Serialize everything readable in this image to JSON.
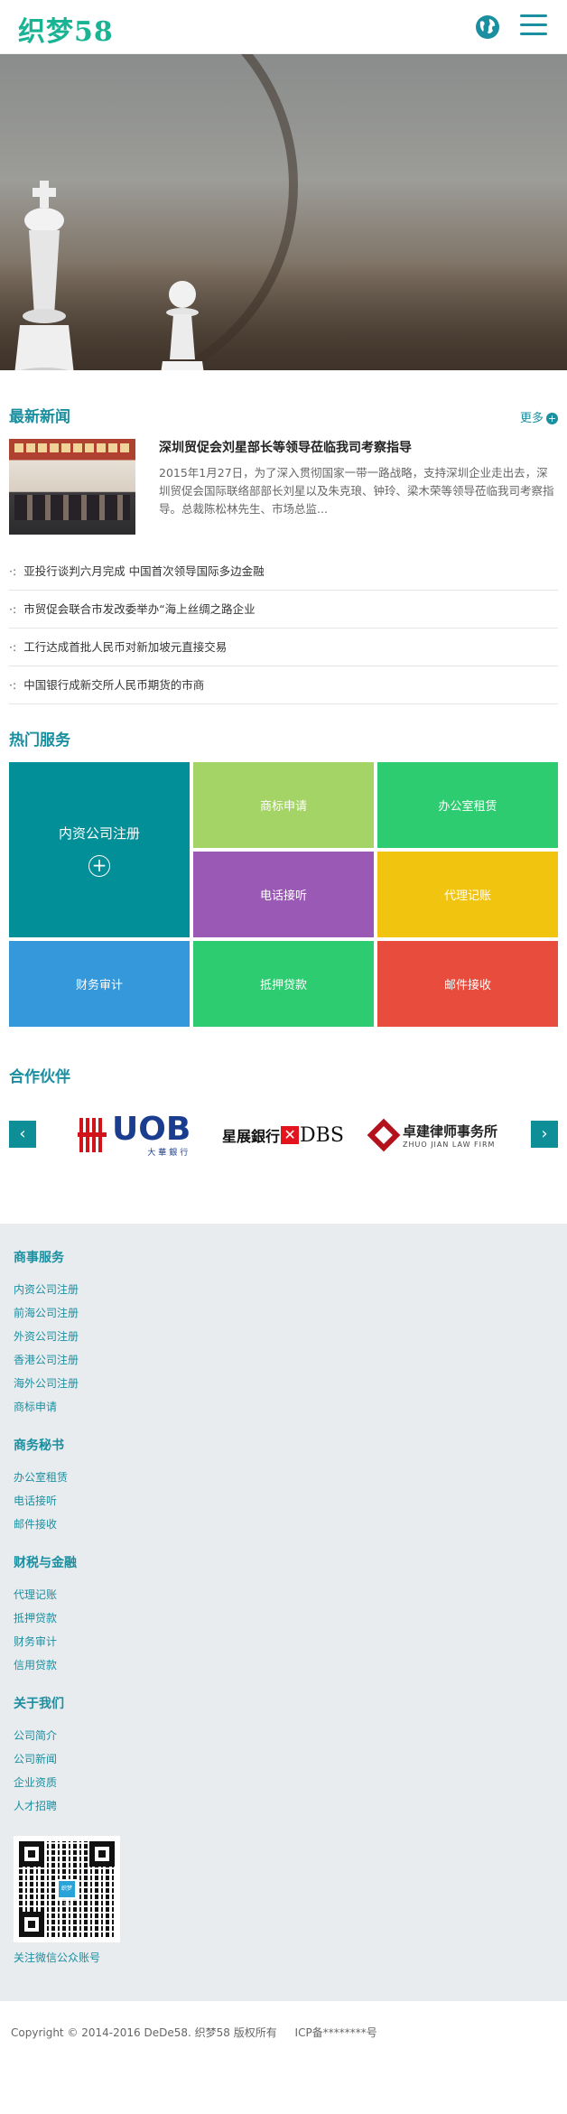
{
  "header": {
    "logo": "织梦58"
  },
  "news": {
    "title": "最新新闻",
    "more": "更多",
    "feature": {
      "title": "深圳贸促会刘星部长等领导莅临我司考察指导",
      "summary": "2015年1月27日，为了深入贯彻国家一带一路战略，支持深圳企业走出去，深圳贸促会国际联络部部长刘星以及朱克琅、钟玲、梁木荣等领导莅临我司考察指导。总裁陈松林先生、市场总监..."
    },
    "items": [
      "亚投行谈判六月完成 中国首次领导国际多边金融",
      "市贸促会联合市发改委举办“海上丝绸之路企业",
      "工行达成首批人民币对新加坡元直接交易",
      "中国银行成新交所人民币期货的市商"
    ]
  },
  "services": {
    "title": "热门服务",
    "tiles": [
      "内资公司注册",
      "商标申请",
      "办公室租赁",
      "电话接听",
      "代理记账",
      "财务审计",
      "抵押贷款",
      "邮件接收"
    ]
  },
  "partners": {
    "title": "合作伙伴",
    "uob": {
      "big": "UOB",
      "small": "大華銀行"
    },
    "dbs": {
      "cn": "星展銀行",
      "x": "✕",
      "en": "DBS"
    },
    "zhuo": {
      "cn": "卓建律师事务所",
      "en": "ZHUO JIAN LAW FIRM"
    },
    "prev": "‹",
    "next": "›"
  },
  "footer": {
    "groups": [
      {
        "title": "商事服务",
        "items": [
          "内资公司注册",
          "前海公司注册",
          "外资公司注册",
          "香港公司注册",
          "海外公司注册",
          "商标申请"
        ]
      },
      {
        "title": "商务秘书",
        "items": [
          "办公室租赁",
          "电话接听",
          "邮件接收"
        ]
      },
      {
        "title": "财税与金融",
        "items": [
          "代理记账",
          "抵押贷款",
          "财务审计",
          "信用贷款"
        ]
      },
      {
        "title": "关于我们",
        "items": [
          "公司简介",
          "公司新闻",
          "企业资质",
          "人才招聘"
        ]
      }
    ],
    "qr_center": "织梦58",
    "qr_caption": "关注微信公众账号"
  },
  "copyright": {
    "text": "Copyright © 2014-2016 DeDe58. 织梦58 版权所有",
    "icp": "ICP备********号"
  },
  "colors": {
    "accent": "#1a8fa0",
    "logo": "#1ab394"
  }
}
